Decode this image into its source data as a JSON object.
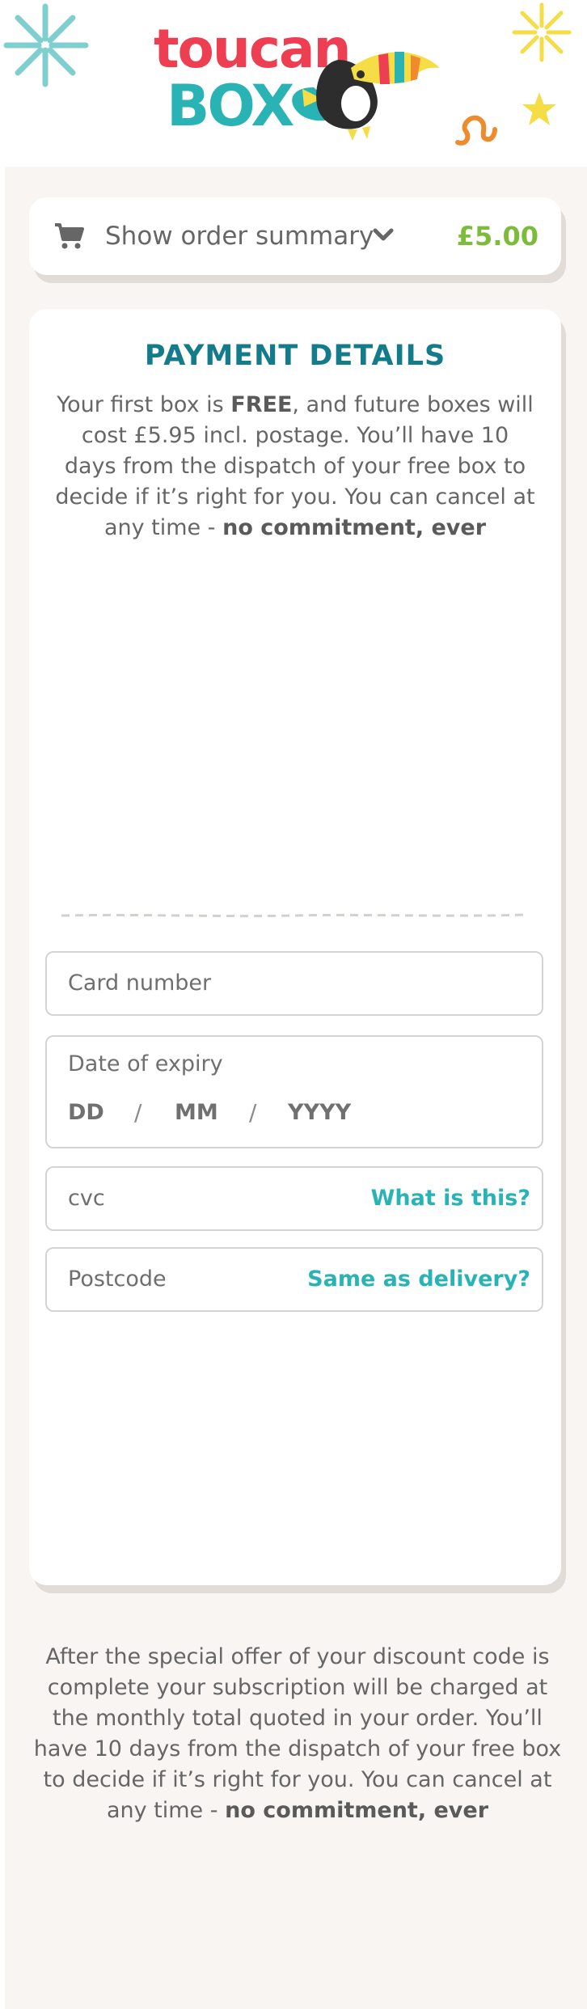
{
  "brand": {
    "logo_line1": "toucan",
    "logo_line2": "BOX",
    "colors": {
      "red": "#ee3e52",
      "teal": "#2ab3b5",
      "green": "#7cbc3a",
      "title": "#147b8a"
    }
  },
  "order_summary": {
    "icon": "cart-icon",
    "label": "Show order summary",
    "chevron_icon": "chevron-down-icon",
    "price": "£5.00"
  },
  "payment": {
    "title": "PAYMENT DETAILS",
    "intro_part1": "Your first box is ",
    "intro_bold1": "FREE",
    "intro_part2": ", and future boxes will cost £5.95 incl. postage. You’ll have 10 days from the dispatch of your free box to decide if it’s right for you. You can cancel at any time - ",
    "intro_bold2": "no commitment, ever",
    "fields": {
      "card_number": {
        "placeholder": "Card number"
      },
      "expiry": {
        "label": "Date of expiry",
        "day": "DD",
        "month": "MM",
        "year": "YYYY",
        "separator": "/"
      },
      "cvc": {
        "placeholder": "cvc",
        "help_link": "What is this?"
      },
      "postcode": {
        "placeholder": "Postcode",
        "help_link": "Same as delivery?"
      }
    }
  },
  "footer": {
    "text": "After the special offer of your discount code is complete your subscription will be charged at the monthly total quoted in your order. You’ll have 10 days from the dispatch of your free box to decide if it’s right for you. You can cancel at any time - ",
    "bold": "no commitment, ever"
  }
}
